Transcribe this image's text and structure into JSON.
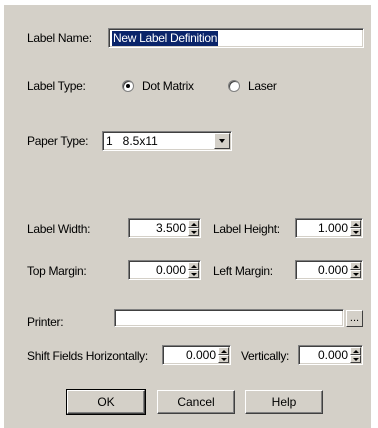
{
  "form": {
    "label_name": {
      "label": "Label Name:",
      "value": "New Label Definition"
    },
    "label_type": {
      "label": "Label Type:",
      "options": [
        {
          "label": "Dot Matrix",
          "selected": true
        },
        {
          "label": "Laser",
          "selected": false
        }
      ]
    },
    "paper_type": {
      "label": "Paper Type:",
      "value": "1   8.5x11"
    },
    "label_width": {
      "label": "Label Width:",
      "value": "3.500"
    },
    "label_height": {
      "label": "Label Height:",
      "value": "1.000"
    },
    "top_margin": {
      "label": "Top Margin:",
      "value": "0.000"
    },
    "left_margin": {
      "label": "Left Margin:",
      "value": "0.000"
    },
    "printer": {
      "label": "Printer:",
      "value": "",
      "browse_label": "..."
    },
    "shift_horizontal": {
      "label": "Shift Fields Horizontally:",
      "value": "0.000"
    },
    "shift_vertical": {
      "label": "Vertically:",
      "value": "0.000"
    }
  },
  "buttons": {
    "ok": "OK",
    "cancel": "Cancel",
    "help": "Help"
  },
  "colors": {
    "dialog_bg": "#d4d0c8",
    "selection": "#0a246a"
  }
}
